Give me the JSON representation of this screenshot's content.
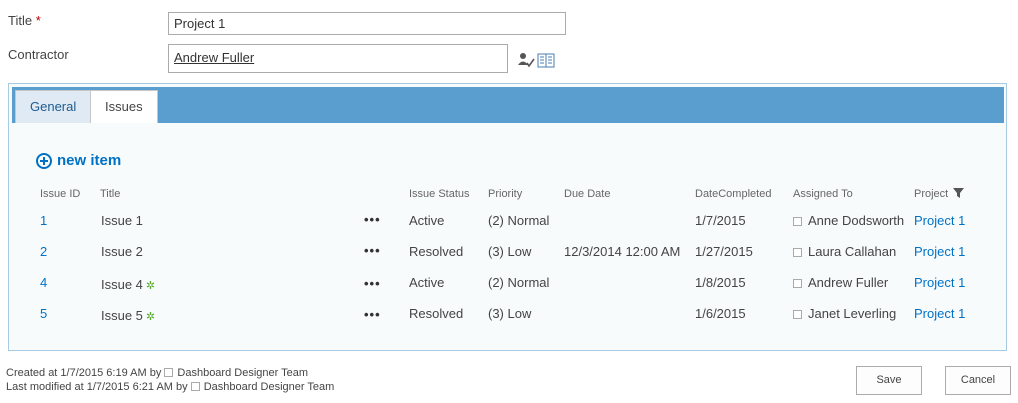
{
  "form": {
    "title_label": "Title",
    "required_mark": "*",
    "title_value": "Project 1",
    "contractor_label": "Contractor",
    "contractor_value": "Andrew Fuller"
  },
  "tabs": [
    {
      "label": "General",
      "selected": false
    },
    {
      "label": "Issues",
      "selected": true
    }
  ],
  "issues": {
    "new_item_label": "new item",
    "columns": [
      "Issue ID",
      "Title",
      "Issue Status",
      "Priority",
      "Due Date",
      "DateCompleted",
      "Assigned To",
      "Project"
    ],
    "rows": [
      {
        "id": "1",
        "title": "Issue 1",
        "is_new": false,
        "status": "Active",
        "priority": "(2) Normal",
        "due": "",
        "completed": "1/7/2015",
        "assigned": "Anne Dodsworth",
        "project": "Project 1"
      },
      {
        "id": "2",
        "title": "Issue 2",
        "is_new": false,
        "status": "Resolved",
        "priority": "(3) Low",
        "due": "12/3/2014 12:00 AM",
        "completed": "1/27/2015",
        "assigned": "Laura Callahan",
        "project": "Project 1"
      },
      {
        "id": "4",
        "title": "Issue 4",
        "is_new": true,
        "status": "Active",
        "priority": "(2) Normal",
        "due": "",
        "completed": "1/8/2015",
        "assigned": "Andrew Fuller",
        "project": "Project 1"
      },
      {
        "id": "5",
        "title": "Issue 5",
        "is_new": true,
        "status": "Resolved",
        "priority": "(3) Low",
        "due": "",
        "completed": "1/6/2015",
        "assigned": "Janet Leverling",
        "project": "Project 1"
      }
    ],
    "ellipsis": "•••",
    "new_marker": "✲"
  },
  "footer": {
    "created_prefix": "Created at 1/7/2015 6:19 AM by",
    "created_by": "Dashboard Designer Team",
    "modified_prefix": "Last modified at 1/7/2015 6:21 AM by",
    "modified_by": "Dashboard Designer Team"
  },
  "buttons": {
    "save": "Save",
    "cancel": "Cancel"
  },
  "colors": {
    "accent": "#0072c6",
    "tab_strip": "#5a9ecf",
    "required": "#b30000",
    "new_marker": "#5aa832"
  }
}
